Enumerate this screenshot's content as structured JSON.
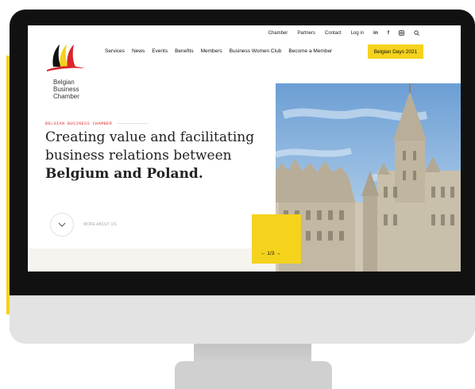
{
  "colors": {
    "accent": "#f5d21c",
    "kicker": "#e0403a",
    "monitor": "#111111"
  },
  "logo": {
    "lines": [
      "Belgian",
      "Business",
      "Chamber"
    ]
  },
  "top_nav": [
    "Chamber",
    "Partners",
    "Contact",
    "Log in"
  ],
  "social": {
    "linkedin": "in",
    "facebook": "f",
    "instagram": "instagram-icon",
    "search": "search-icon"
  },
  "main_nav": [
    "Services",
    "News",
    "Events",
    "Benefits",
    "Members",
    "Business Women Club",
    "Become a Member"
  ],
  "cta_label": "Belgian Days 2021",
  "hero": {
    "kicker": "BELGIAN BUSINESS CHAMBER",
    "line1": "Creating value and facilitating",
    "line2": "business relations between",
    "line3": "Belgium and Poland.",
    "more_label": "MORE ABOUT US",
    "slider_counter": "← 1/3 →"
  }
}
